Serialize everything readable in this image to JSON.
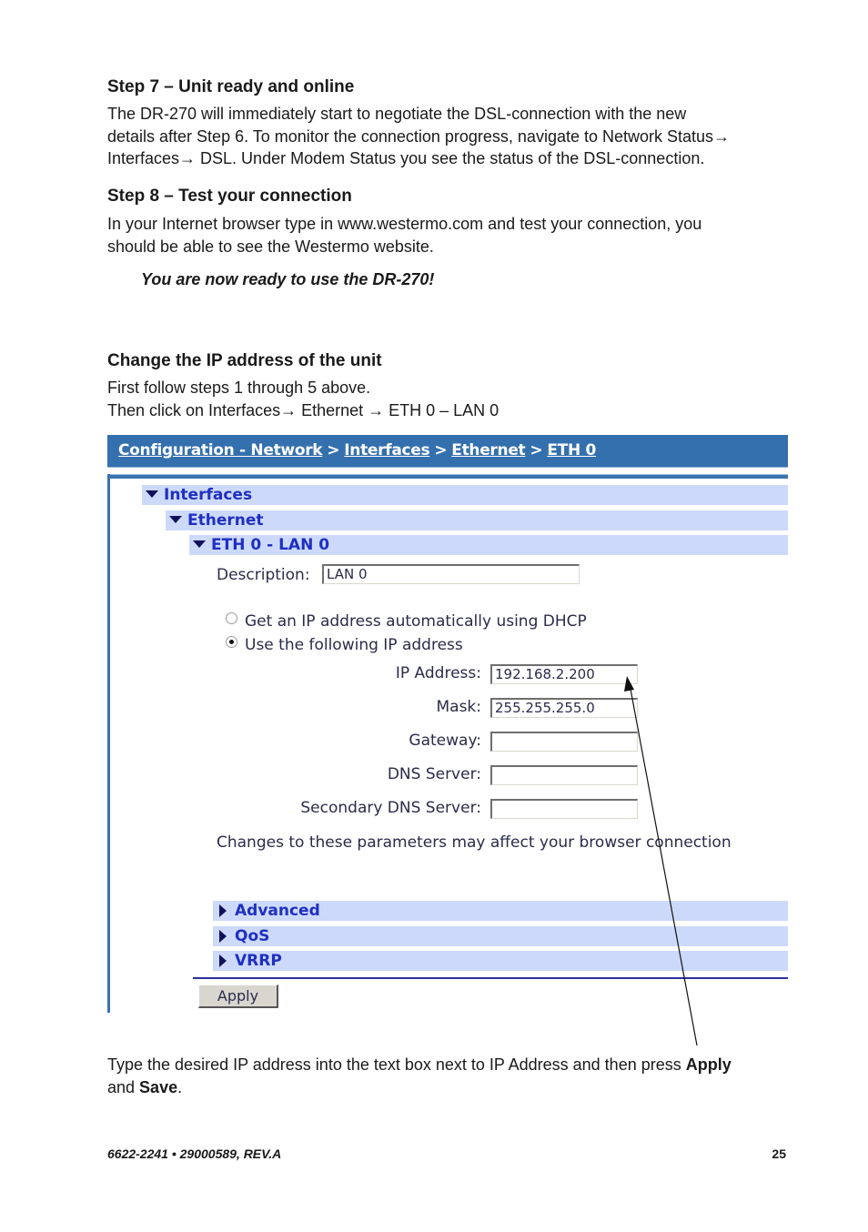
{
  "step7": {
    "heading": "Step 7 – Unit ready and online",
    "lines": [
      "The DR-270 will immediately start to negotiate the DSL-connection with the new",
      "details after Step 6. To monitor the connection progress, navigate to Network Status→",
      "Interfaces→ DSL. Under Modem Status you see the status of the DSL-connection."
    ]
  },
  "step8": {
    "heading": "Step 8 – Test your connection",
    "lines": [
      "In your Internet browser type in www.westermo.com and test your connection, you",
      "should be able to see the Westermo website."
    ],
    "ready_note": "You are now ready to use the DR-270!"
  },
  "change_ip": {
    "heading": "Change the IP address of the unit",
    "lines": [
      "First follow steps 1 through 5 above.",
      "Then click on Interfaces→ Ethernet → ETH 0 – LAN 0"
    ]
  },
  "screenshot": {
    "breadcrumb": [
      "Configuration - Network",
      "Interfaces",
      "Ethernet",
      "ETH 0"
    ],
    "breadcrumb_separator": ">",
    "tree": [
      "Interfaces",
      "Ethernet",
      "ETH 0 - LAN 0"
    ],
    "description_label": "Description:",
    "description_value": "LAN 0",
    "radio_options": [
      {
        "label": "Get an IP address automatically using DHCP",
        "selected": false
      },
      {
        "label": "Use the following IP address",
        "selected": true
      }
    ],
    "fields": [
      {
        "label": "IP Address:",
        "value": "192.168.2.200"
      },
      {
        "label": "Mask:",
        "value": "255.255.255.0"
      },
      {
        "label": "Gateway:",
        "value": ""
      },
      {
        "label": "DNS Server:",
        "value": ""
      },
      {
        "label": "Secondary DNS Server:",
        "value": ""
      }
    ],
    "warning": "Changes to these parameters may affect your browser connection",
    "collapsed_sections": [
      "Advanced",
      "QoS",
      "VRRP"
    ],
    "apply_label": "Apply",
    "colors": {
      "header_bar": "#3470ad",
      "section_bg": "#ccd9fa",
      "section_text": "#1f2fc2"
    }
  },
  "instruction": {
    "text_before": "Type the desired IP address into the text box next to IP Address and then press ",
    "bold1": "Apply",
    "text_mid": "and ",
    "bold2": "Save",
    "text_end": "."
  },
  "footer": {
    "doc_id": "6622-2241 • 29000589, REV.A",
    "page_number": "25"
  }
}
